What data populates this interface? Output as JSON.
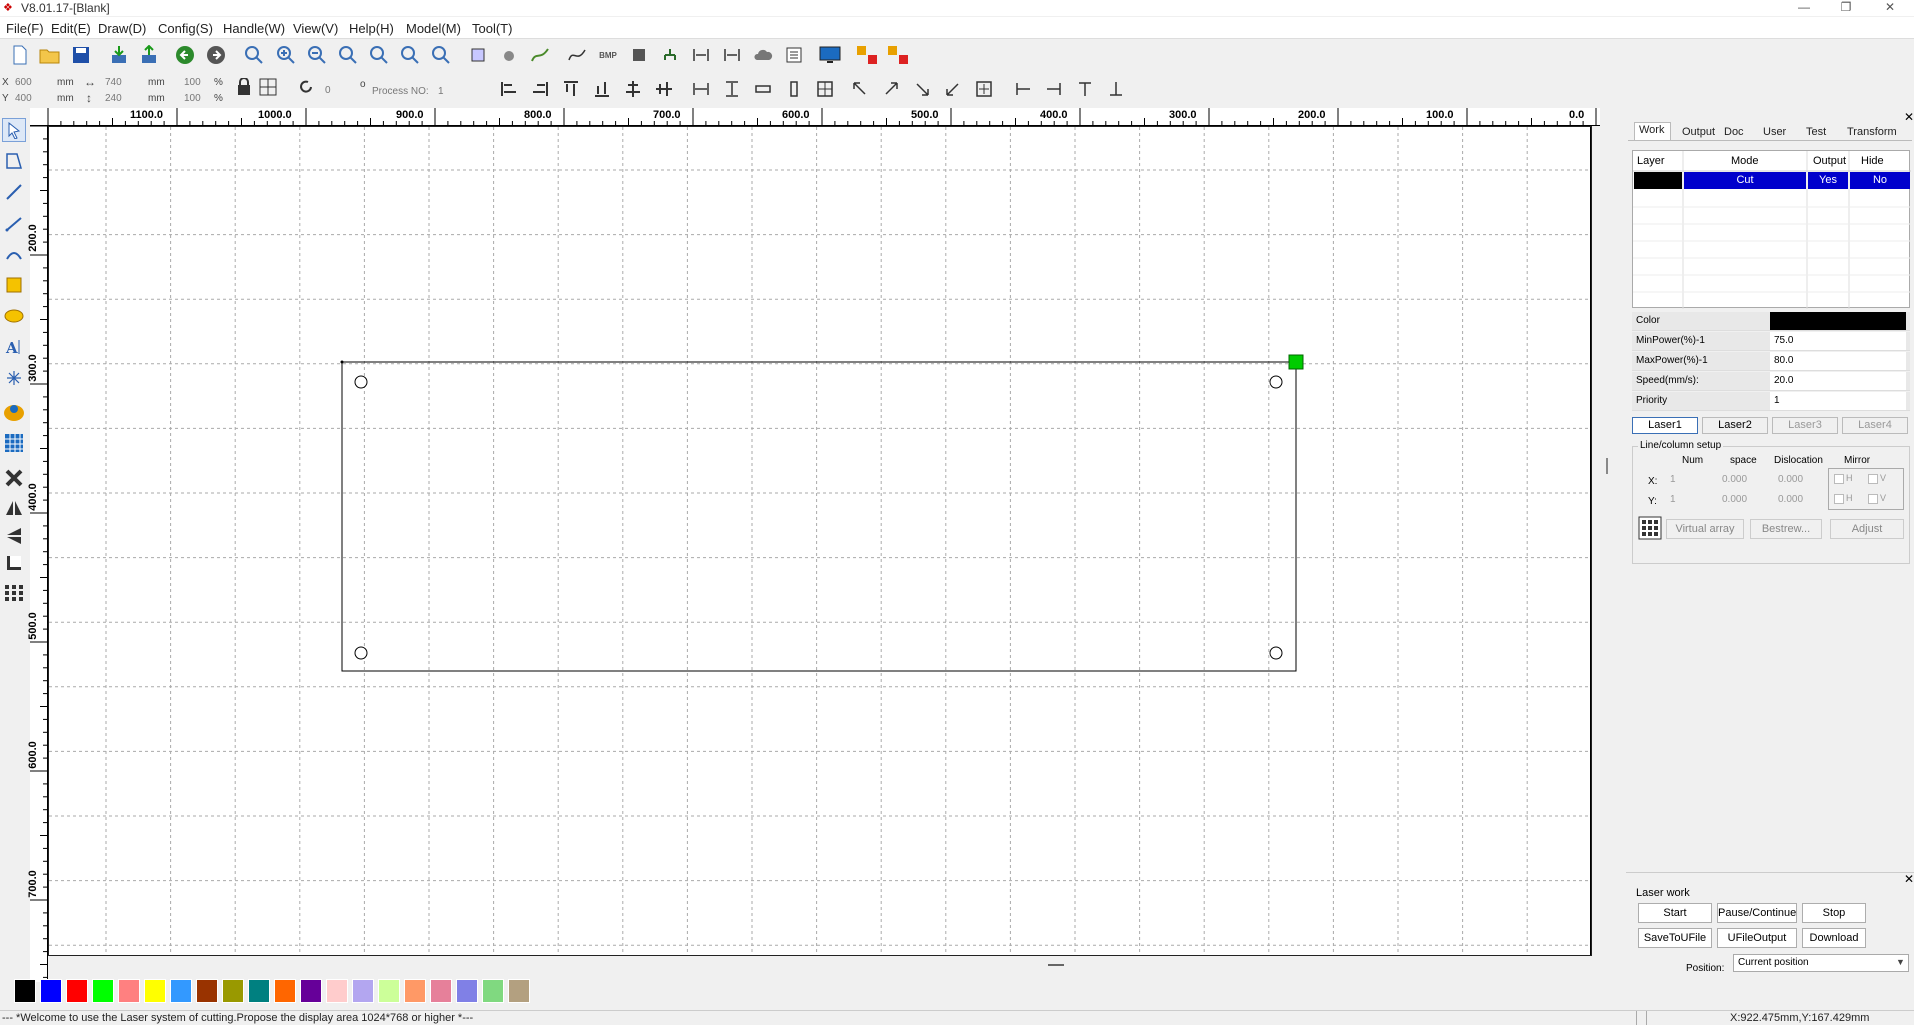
{
  "window": {
    "title": "V8.01.17-[Blank]",
    "minimize": "—",
    "restore": "❐",
    "close": "✕"
  },
  "menu": [
    "File(F)",
    "Edit(E)",
    "Draw(D)",
    "Config(S)",
    "Handle(W)",
    "View(V)",
    "Help(H)",
    "Model(M)",
    "Tool(T)"
  ],
  "props": {
    "x_label": "X",
    "x_val": "600",
    "y_label": "Y",
    "y_val": "400",
    "unit": "mm",
    "w_val": "740",
    "h_val": "240",
    "scale_w": "100",
    "scale_h": "100",
    "pct": "%",
    "rotate_val": "0",
    "deg": "o",
    "process_label": "Process NO:",
    "process_val": "1"
  },
  "ruler": {
    "h": [
      "1100.0",
      "1000.0",
      "900.0",
      "800.0",
      "700.0",
      "600.0",
      "500.0",
      "400.0",
      "300.0",
      "200.0",
      "100.0",
      "0.0"
    ],
    "v": [
      "200.0",
      "300.0",
      "400.0",
      "500.0",
      "600.0",
      "700.0"
    ]
  },
  "tabs": [
    "Work",
    "Output",
    "Doc",
    "User",
    "Test",
    "Transform"
  ],
  "layer_table": {
    "headers": [
      "Layer",
      "Mode",
      "Output",
      "Hide"
    ],
    "rows": [
      {
        "color": "#000000",
        "mode": "Cut",
        "output": "Yes",
        "hide": "No"
      }
    ]
  },
  "layer_props": [
    {
      "key": "Color",
      "value": ""
    },
    {
      "key": "MinPower(%)-1",
      "value": "75.0"
    },
    {
      "key": "MaxPower(%)-1",
      "value": "80.0"
    },
    {
      "key": "Speed(mm/s):",
      "value": "20.0"
    },
    {
      "key": "Priority",
      "value": "1"
    }
  ],
  "lasers": [
    "Laser1",
    "Laser2",
    "Laser3",
    "Laser4"
  ],
  "array": {
    "title": "Line/column setup",
    "cols": [
      "Num",
      "space",
      "Dislocation",
      "Mirror"
    ],
    "x_label": "X:",
    "y_label": "Y:",
    "num": "1",
    "space": "0.000",
    "dislocation": "0.000",
    "h": "H",
    "v": "V",
    "virtual": "Virtual array",
    "bestrew": "Bestrew...",
    "adjust": "Adjust"
  },
  "laser_work": {
    "title": "Laser work",
    "buttons": [
      "Start",
      "Pause/Continue",
      "Stop",
      "SaveToUFile",
      "UFileOutput",
      "Download"
    ],
    "position_label": "Position:",
    "position_val": "Current position"
  },
  "palette": [
    "#000000",
    "#0000ff",
    "#ff0000",
    "#00ff00",
    "#ff8080",
    "#ffff00",
    "#3399ff",
    "#993300",
    "#999900",
    "#008080",
    "#ff6600",
    "#660099",
    "#ffcccc",
    "#b3a6f0",
    "#ccff99",
    "#ff9966",
    "#e6809a",
    "#8080e6",
    "#80d980",
    "#b3a080"
  ],
  "status": {
    "message": "--- *Welcome to use the Laser system of cutting.Propose the display area 1024*768 or higher *---",
    "coords": "X:922.475mm,Y:167.429mm"
  },
  "colors": {
    "selected_row": "#0000cc",
    "handle": "#00cc00"
  }
}
